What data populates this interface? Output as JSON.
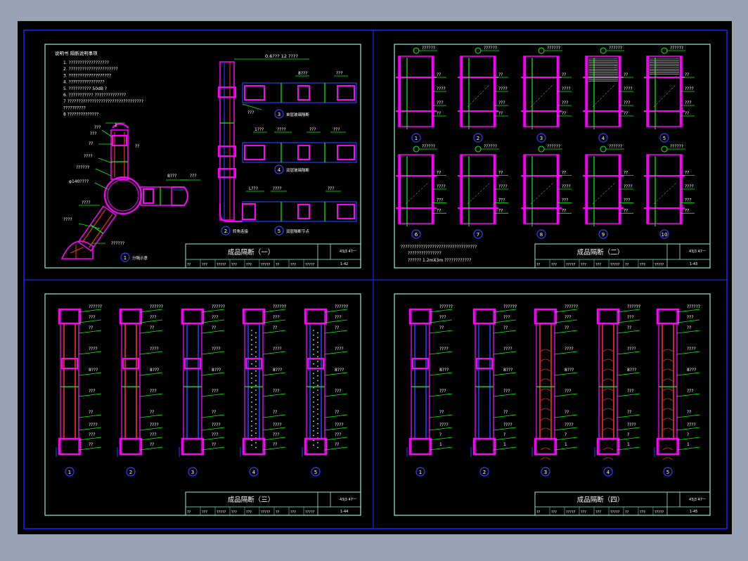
{
  "colors": {
    "outer_bg": "#98a3b5",
    "drawing_bg": "#000000",
    "border": "#1a22ff",
    "sheet_frame": "#8ff0d0",
    "leader": "#00ff00",
    "profile": "#ff00ff",
    "glass": "#ff2a2a",
    "blue": "#2040ff",
    "text": "#ffffff",
    "callout": "#3040ff"
  },
  "sheets": [
    {
      "id": "s1",
      "title": "成品隔断（一）",
      "code": "43j3 47一",
      "page": "1-42",
      "notes_title": "说明书 隔断说明事项",
      "notes": [
        "1. ??????????????????",
        "2. ??????????????????????",
        "3. ???????????????????",
        "4. ????????????????",
        "5. ?????????? 50dB ?",
        "6. ??????????? ??????????????",
        "7 ??????????????????????????????????",
        "   ??????????",
        "8 ??????????????"
      ],
      "labels": [
        "1",
        "???",
        "???",
        "??",
        "????",
        "??????",
        "φ140????",
        "????",
        "??????",
        "8???",
        "???",
        "??",
        "0.6???  12  ????",
        "8???",
        "???",
        "???",
        "????",
        "1???",
        "???",
        "???",
        "L???",
        "????",
        "???",
        "??"
      ],
      "callouts": [
        {
          "n": "1",
          "caption": "分隔示意"
        },
        {
          "n": "2",
          "caption": "转角连接"
        },
        {
          "n": "3",
          "caption": "单层玻璃隔断"
        },
        {
          "n": "4",
          "caption": "双层玻璃隔断"
        },
        {
          "n": "5",
          "caption": "双层隔断节点"
        }
      ]
    },
    {
      "id": "s2",
      "title": "成品隔断（二）",
      "code": "43j3 47一",
      "page": "1-43",
      "footnote": [
        "??????????????????????????????????",
        "???????????????",
        "??????  1.2mX3m    ????????????"
      ],
      "callouts": [
        "1",
        "2",
        "3",
        "4",
        "5",
        "6",
        "7",
        "8",
        "9",
        "10"
      ],
      "labels": [
        "??????",
        "??",
        "????",
        "???",
        "??"
      ]
    },
    {
      "id": "s3",
      "title": "成品隔断（三）",
      "code": "43j3 47一",
      "page": "1-44",
      "callouts": [
        "1",
        "2",
        "3",
        "4",
        "5"
      ],
      "labels": [
        "??????",
        "???",
        "??",
        "????",
        "8???",
        "???",
        "??"
      ]
    },
    {
      "id": "s4",
      "title": "成品隔断（四）",
      "code": "43j3 47一",
      "page": "1-45",
      "callouts": [
        "1",
        "2",
        "3",
        "4",
        "5"
      ],
      "labels": [
        "??????",
        "???",
        "??",
        "????",
        "8???",
        "?",
        "1"
      ]
    }
  ]
}
